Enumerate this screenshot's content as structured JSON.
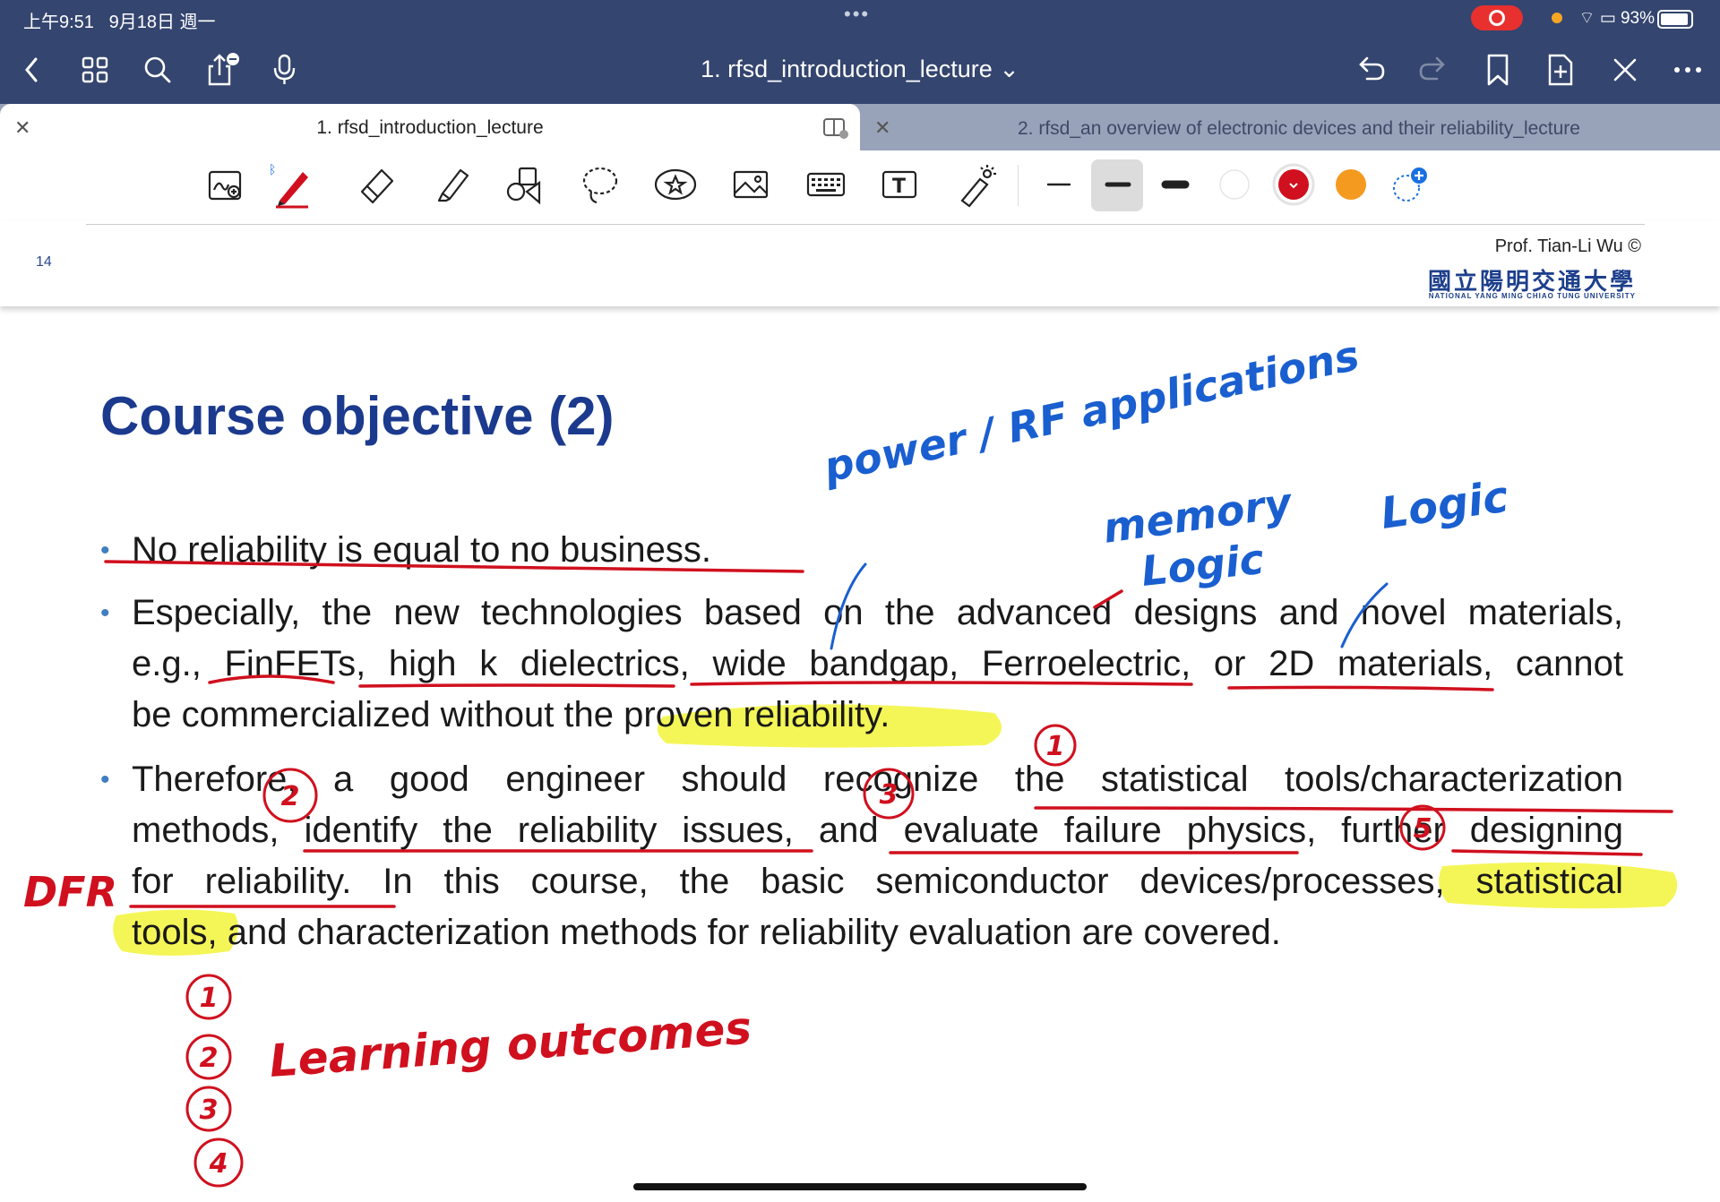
{
  "status": {
    "time": "上午9:51",
    "date": "9月18日 週一",
    "battery": "93%"
  },
  "nav": {
    "title": "1. rfsd_introduction_lecture ⌄"
  },
  "tabs": [
    {
      "label": "1. rfsd_introduction_lecture"
    },
    {
      "label": "2. rfsd_an overview of electronic devices and their reliability_lecture"
    }
  ],
  "toolbar": {
    "colors": {
      "red": "#d0101e",
      "orange": "#f39a1f",
      "white": "#ffffff"
    }
  },
  "page_header": {
    "page_number": "14",
    "author": "Prof. Tian-Li Wu ©",
    "university": "國立陽明交通大學",
    "university_en": "NATIONAL YANG MING CHIAO TUNG UNIVERSITY"
  },
  "slide": {
    "title": "Course objective (2)",
    "bullet1": "No reliability is equal to no business.",
    "bullet2": {
      "line1": "Especially, the new technologies based on the advanced designs and novel materials,",
      "line2": "e.g., FinFETs, high k dielectrics, wide bandgap, Ferroelectric, or 2D materials, cannot",
      "line3": "be commercialized without the proven reliability."
    },
    "bullet3": {
      "line1": "Therefore, a good engineer should recognize the statistical tools/characterization",
      "line2": "methods, identify the reliability issues, and evaluate failure physics, further designing",
      "line3": "for reliability. In this course, the basic semiconductor devices/processes, statistical",
      "line4": "tools, and characterization methods for reliability evaluation are covered."
    }
  },
  "handwriting": {
    "power": "power / RF applications",
    "memory": "memory",
    "logic1": "Logic",
    "logic2": "Logic",
    "dfr": "DFR",
    "learning": "Learning outcomes",
    "n1": "1",
    "n2": "2",
    "n3": "3",
    "n4": "4",
    "n5": "5"
  }
}
